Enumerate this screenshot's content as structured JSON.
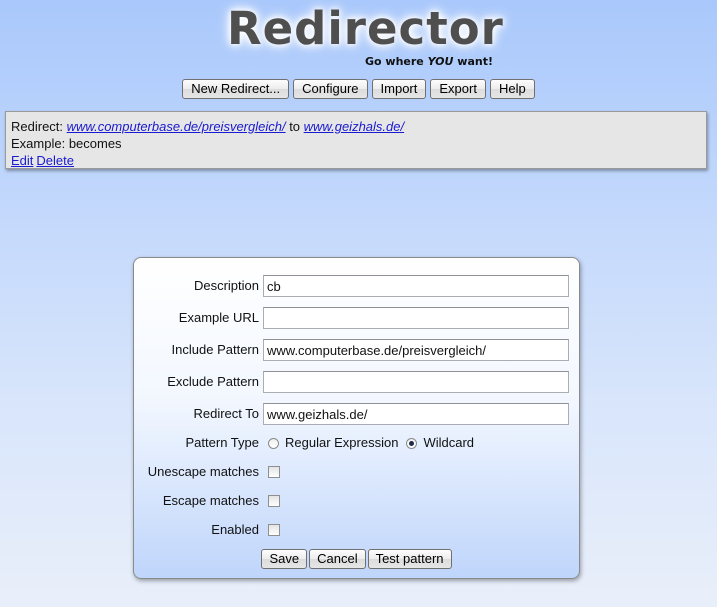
{
  "header": {
    "title": "Redirector",
    "tagline_before": "Go where ",
    "tagline_emphasis": "YOU",
    "tagline_after": " want!"
  },
  "toolbar": {
    "new_redirect": "New Redirect...",
    "configure": "Configure",
    "import": "Import",
    "export": "Export",
    "help": "Help"
  },
  "redirect": {
    "prefix": "Redirect: ",
    "include_pattern": "www.computerbase.de/preisvergleich/",
    "to_word": " to ",
    "redirect_to": "www.geizhals.de/",
    "example_label": "Example: ",
    "example_text": "becomes",
    "edit_label": "Edit",
    "delete_label": "Delete"
  },
  "form": {
    "description_label": "Description",
    "description_value": "cb",
    "example_url_label": "Example URL",
    "example_url_value": "",
    "include_pattern_label": "Include Pattern",
    "include_pattern_value": "www.computerbase.de/preisvergleich/",
    "exclude_pattern_label": "Exclude Pattern",
    "exclude_pattern_value": "",
    "redirect_to_label": "Redirect To",
    "redirect_to_value": "www.geizhals.de/",
    "pattern_type_label": "Pattern Type",
    "pattern_type_options": [
      "Regular Expression",
      "Wildcard"
    ],
    "pattern_type_selected": "Wildcard",
    "unescape_label": "Unescape matches",
    "unescape_checked": false,
    "escape_label": "Escape matches",
    "escape_checked": false,
    "enabled_label": "Enabled",
    "enabled_checked": false,
    "save_label": "Save",
    "cancel_label": "Cancel",
    "test_label": "Test pattern"
  }
}
